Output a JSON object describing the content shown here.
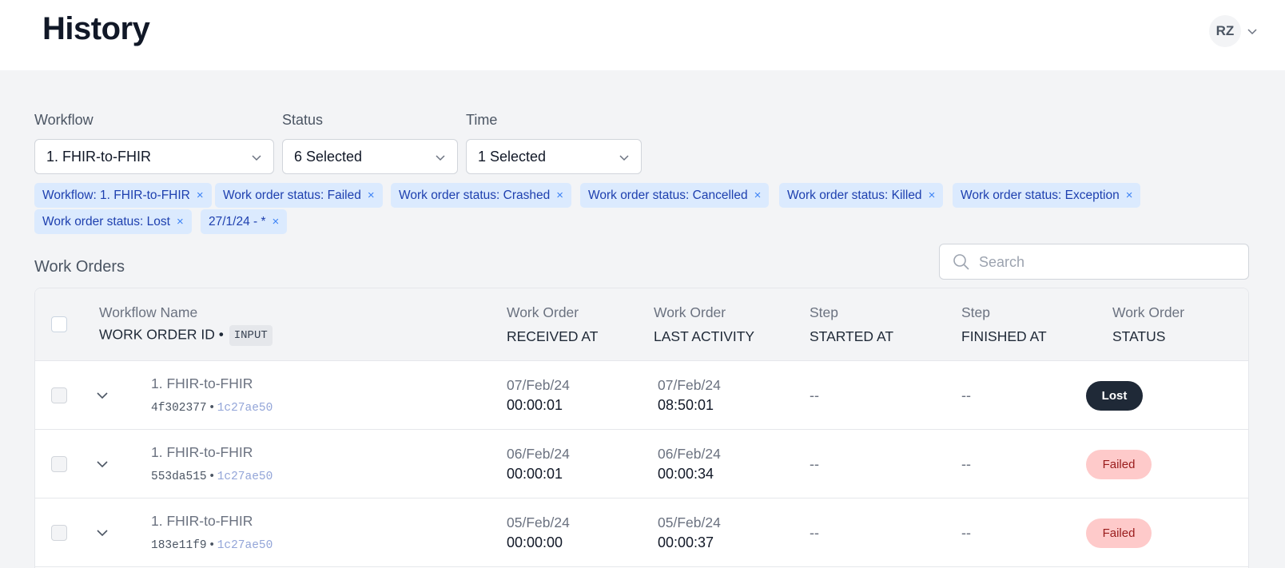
{
  "header": {
    "title": "History",
    "user_initials": "RZ"
  },
  "filters": {
    "workflow": {
      "label": "Workflow",
      "value": "1. FHIR-to-FHIR"
    },
    "status": {
      "label": "Status",
      "value": "6 Selected"
    },
    "time": {
      "label": "Time",
      "value": "1 Selected"
    }
  },
  "chips": [
    "Workflow: 1. FHIR-to-FHIR",
    "Work order status: Failed",
    "Work order status: Crashed",
    "Work order status: Cancelled",
    "Work order status: Killed",
    "Work order status: Exception",
    "Work order status: Lost",
    "27/1/24 - *"
  ],
  "chip_remove_glyph": "×",
  "work_orders": {
    "title": "Work Orders",
    "search_placeholder": "Search",
    "columns": {
      "workflow_top": "Workflow Name",
      "workflow_bottom": "WORK ORDER ID",
      "input_tag": "INPUT",
      "received_top": "Work Order",
      "received_bottom": "RECEIVED AT",
      "activity_top": "Work Order",
      "activity_bottom": "LAST ACTIVITY",
      "started_top": "Step",
      "started_bottom": "STARTED AT",
      "finished_top": "Step",
      "finished_bottom": "FINISHED AT",
      "status_top": "Work Order",
      "status_bottom": "STATUS"
    },
    "rows": [
      {
        "workflow": "1. FHIR-to-FHIR",
        "id": "4f302377",
        "input": "1c27ae50",
        "received_date": "07/Feb/24",
        "received_time": "00:00:01",
        "activity_date": "07/Feb/24",
        "activity_time": "08:50:01",
        "started": "--",
        "finished": "--",
        "status": "Lost"
      },
      {
        "workflow": "1. FHIR-to-FHIR",
        "id": "553da515",
        "input": "1c27ae50",
        "received_date": "06/Feb/24",
        "received_time": "00:00:01",
        "activity_date": "06/Feb/24",
        "activity_time": "00:00:34",
        "started": "--",
        "finished": "--",
        "status": "Failed"
      },
      {
        "workflow": "1. FHIR-to-FHIR",
        "id": "183e11f9",
        "input": "1c27ae50",
        "received_date": "05/Feb/24",
        "received_time": "00:00:00",
        "activity_date": "05/Feb/24",
        "activity_time": "00:00:37",
        "started": "--",
        "finished": "--",
        "status": "Failed"
      }
    ]
  },
  "colors": {
    "chip_bg": "#dbeafe",
    "chip_text": "#1e40af",
    "lost_badge": "#1f2937",
    "failed_badge": "#fecaca"
  }
}
